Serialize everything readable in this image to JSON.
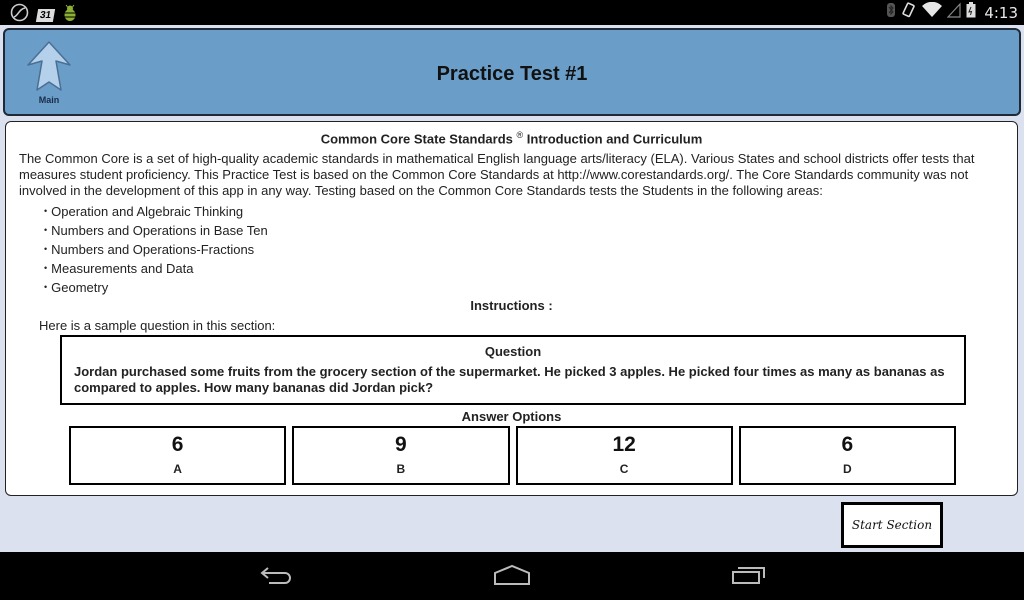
{
  "status_bar": {
    "left_icons": [
      "sync-icon",
      "calendar-31-icon",
      "debug-bug-icon"
    ],
    "calendar_day": "31",
    "right_icons": [
      "bluetooth-icon",
      "screen-rotation-icon",
      "wifi-icon",
      "cell-signal-icon",
      "battery-icon"
    ],
    "time": "4:13"
  },
  "header": {
    "main_button_label": "Main",
    "title": "Practice Test #1",
    "color": "#6a9ec9"
  },
  "content": {
    "intro_title": "Common Core State Standards",
    "intro_title_mark": "®",
    "intro_title_suffix": "Introduction and Curriculum",
    "intro_body": "The Common Core is a set of high-quality academic standards in mathematical English language arts/literacy (ELA). Various States and school districts offer tests that measures student proficiency. This Practice Test is based on the Common Core Standards at http://www.corestandards.org/. The Core Standards community was not involved in the development of this app in any way. Testing based on the Common Core Standards tests the Students in the following areas:",
    "areas": [
      "Operation and Algebraic Thinking",
      "Numbers and Operations in Base Ten",
      "Numbers and Operations-Fractions",
      "Measurements and Data",
      "Geometry"
    ],
    "instructions_title": "Instructions :",
    "sample_intro": "Here is a sample question in this section:",
    "question": {
      "label": "Question",
      "text": "Jordan purchased some fruits from the grocery section of the supermarket. He picked 3 apples. He picked four times as many as bananas as compared to apples. How many bananas did Jordan pick?"
    },
    "answer_options_title": "Answer Options",
    "answers": [
      {
        "value": "6",
        "letter": "A"
      },
      {
        "value": "9",
        "letter": "B"
      },
      {
        "value": "12",
        "letter": "C"
      },
      {
        "value": "6",
        "letter": "D"
      }
    ]
  },
  "actions": {
    "start_section_label": "Start Section"
  },
  "nav_bar": {
    "buttons": [
      "back-icon",
      "home-icon",
      "recent-apps-icon"
    ]
  }
}
